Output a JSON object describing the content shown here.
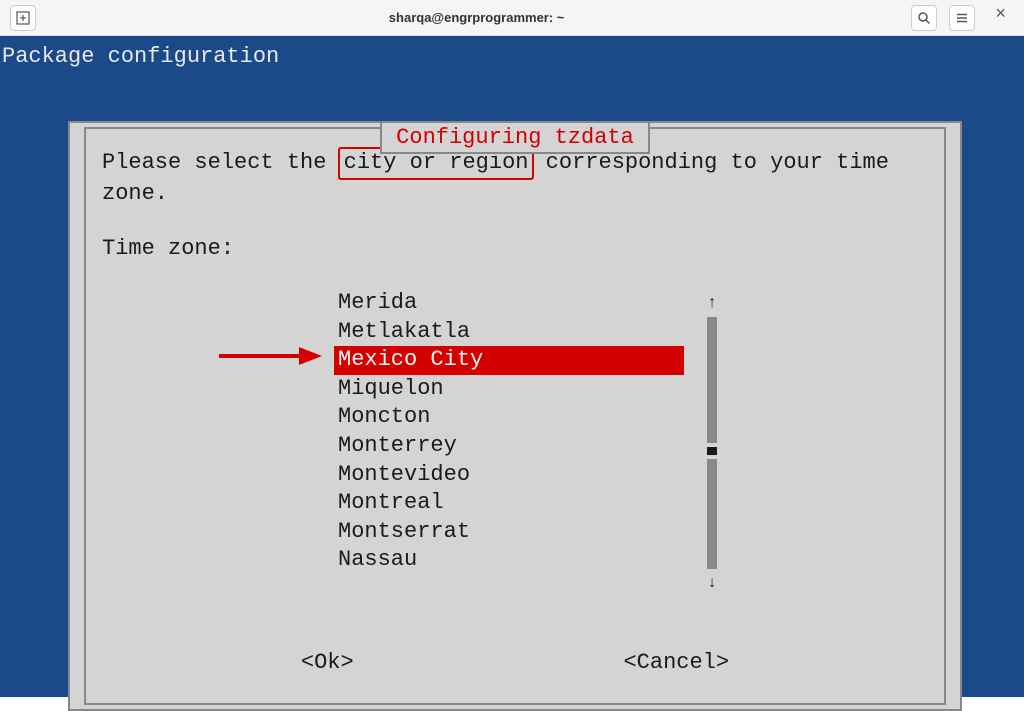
{
  "window": {
    "title": "sharqa@engrprogrammer: ~"
  },
  "terminal": {
    "header": "Package configuration"
  },
  "dialog": {
    "title": "Configuring tzdata",
    "prompt_before": "Please select the ",
    "prompt_highlight": "city or region",
    "prompt_after": " corresponding to your time zone.",
    "label": "Time zone:",
    "items": [
      {
        "label": "Merida",
        "selected": false
      },
      {
        "label": "Metlakatla",
        "selected": false
      },
      {
        "label": "Mexico City",
        "selected": true
      },
      {
        "label": "Miquelon",
        "selected": false
      },
      {
        "label": "Moncton",
        "selected": false
      },
      {
        "label": "Monterrey",
        "selected": false
      },
      {
        "label": "Montevideo",
        "selected": false
      },
      {
        "label": "Montreal",
        "selected": false
      },
      {
        "label": "Montserrat",
        "selected": false
      },
      {
        "label": "Nassau",
        "selected": false
      }
    ],
    "ok": "<Ok>",
    "cancel": "<Cancel>"
  },
  "scroll": {
    "up": "↑",
    "down": "↓"
  },
  "icons": {
    "new_tab": "⊕",
    "search": "Q",
    "menu": "≡",
    "close": "×"
  }
}
